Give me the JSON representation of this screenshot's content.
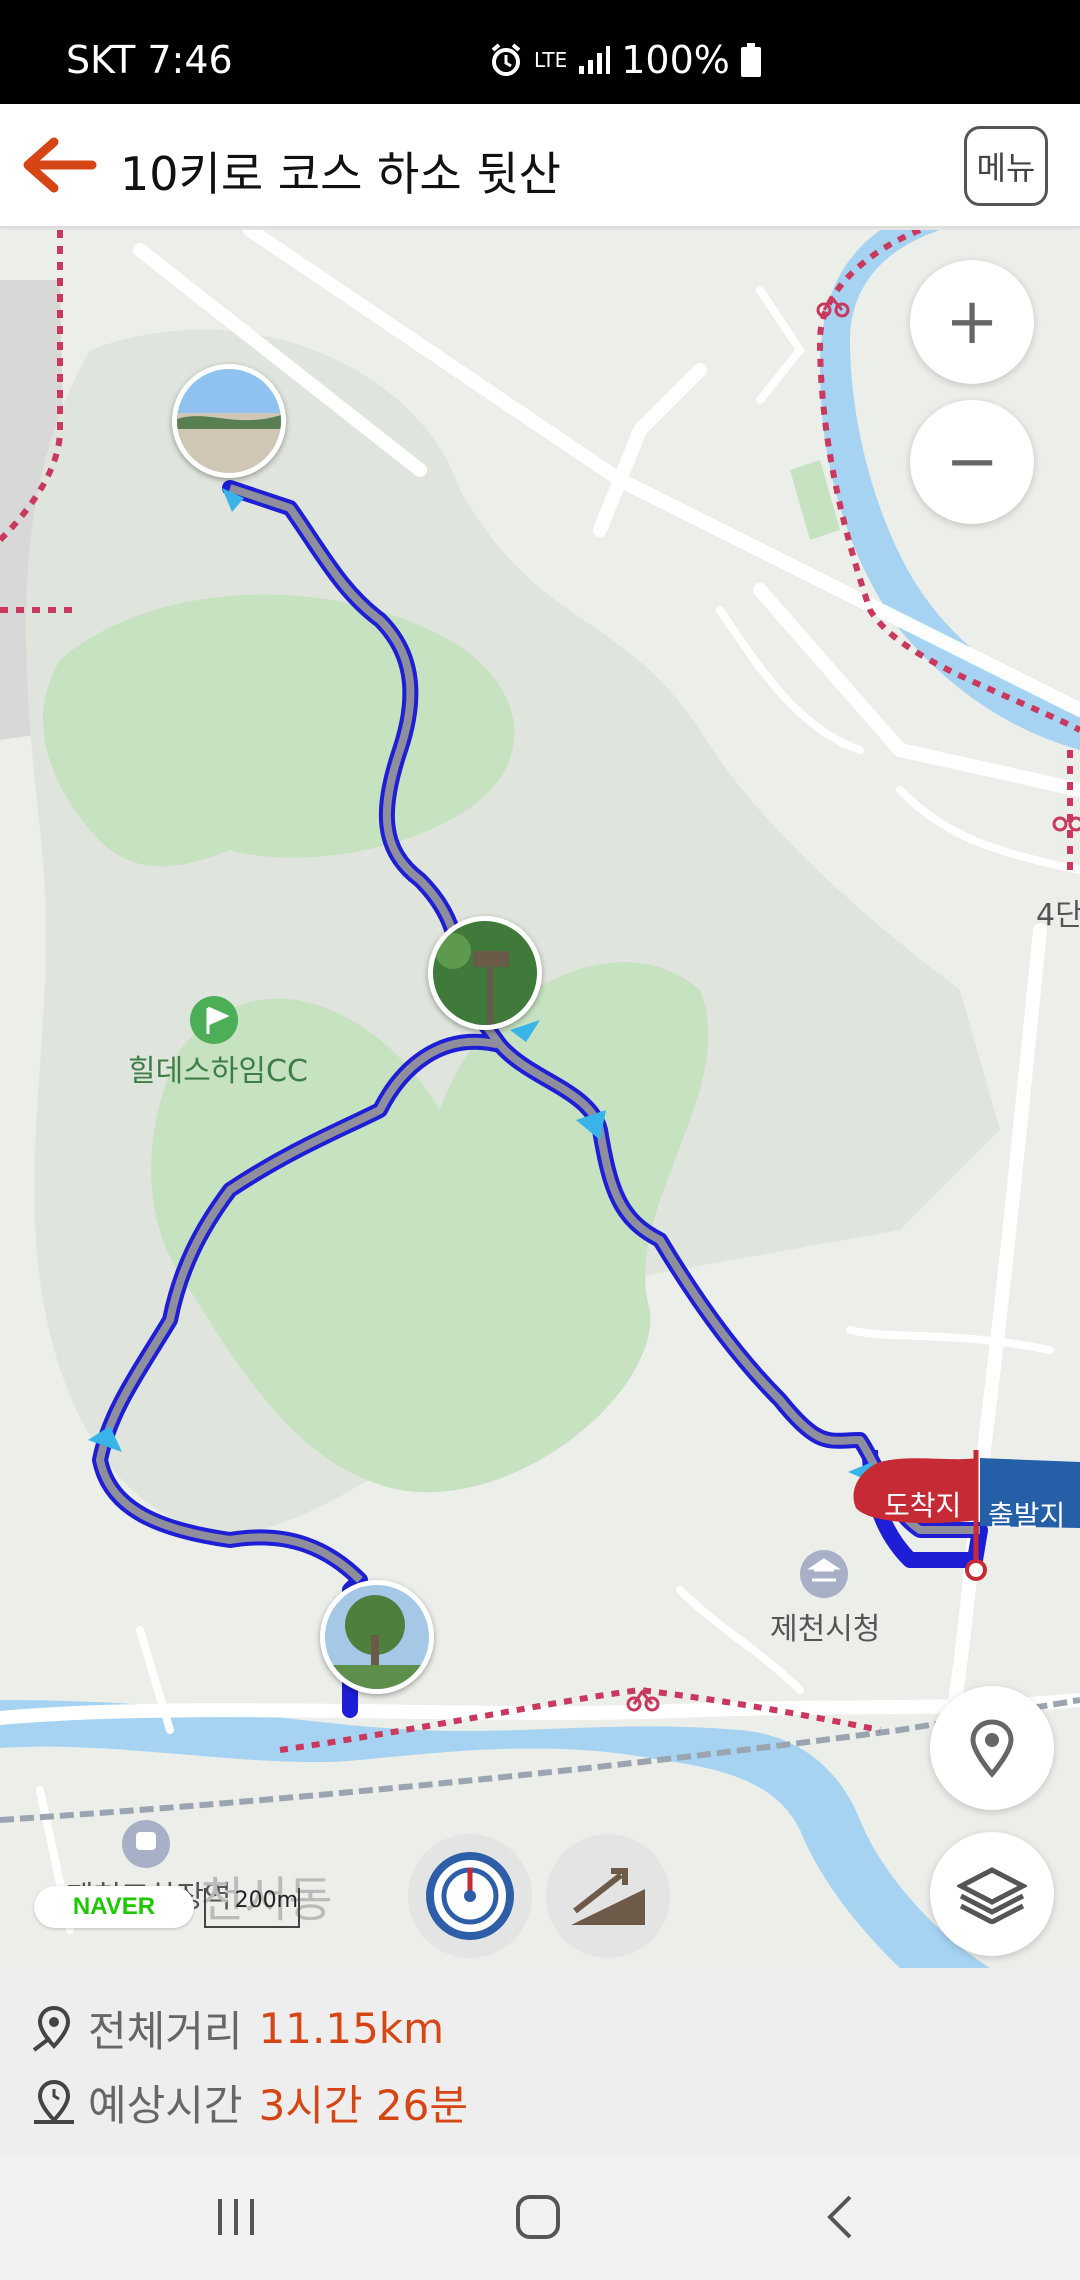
{
  "status_bar": {
    "carrier_time": "SKT 7:46",
    "network": "LTE",
    "battery": "100%",
    "icons": [
      "alarm-icon",
      "lte-icon",
      "signal-icon",
      "battery-icon"
    ]
  },
  "header": {
    "title": "10키로 코스 하소 뒷산",
    "menu_label": "메뉴",
    "back_icon": "back-arrow-icon"
  },
  "map": {
    "zoom_in": "+",
    "zoom_out": "−",
    "labels": {
      "golf": "힐데스하임CC",
      "cityhall": "제천시청",
      "station": "제천조차장역",
      "district": "천서동",
      "partial": "4단"
    },
    "flags": {
      "arrival": "도착지",
      "departure": "출발지"
    },
    "attribution": "NAVER",
    "scale": "200m"
  },
  "info": {
    "distance_label": "전체거리",
    "distance_value": "11.15km",
    "time_label": "예상시간",
    "time_value": "3시간 26분"
  },
  "colors": {
    "accent": "#d64514",
    "route": "#1e1ed6",
    "trail": "#c9385d",
    "water": "#a6d3f2",
    "park": "#c6e2c0"
  },
  "nav": {
    "icons": [
      "recent-apps-icon",
      "home-icon",
      "back-icon"
    ]
  }
}
